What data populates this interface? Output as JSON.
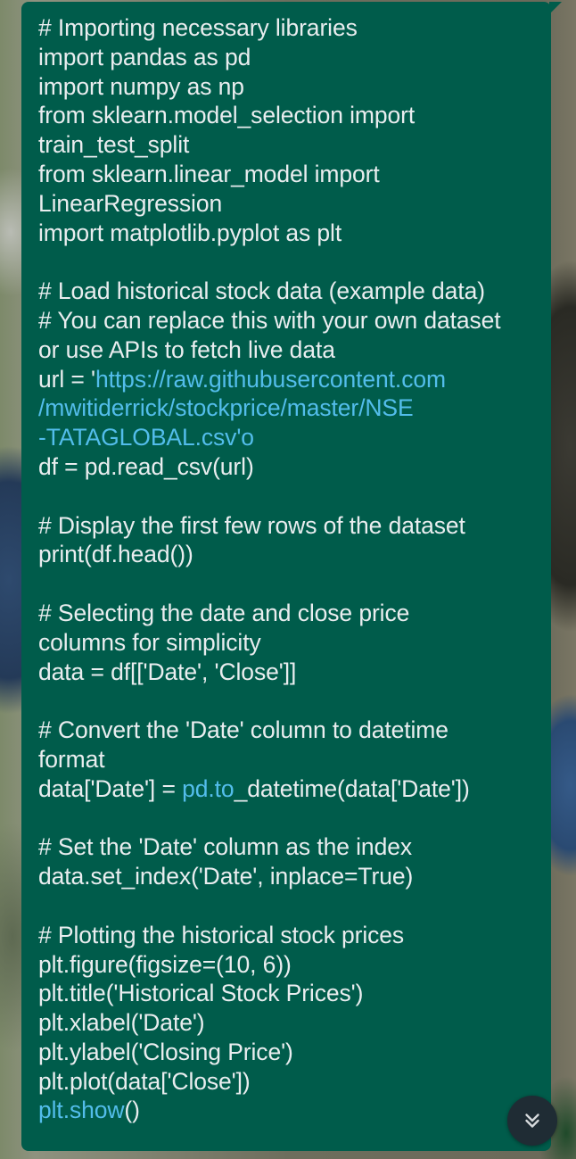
{
  "message": {
    "lines": [
      {
        "text": "# Importing necessary libraries"
      },
      {
        "text": "import pandas as pd"
      },
      {
        "text": "import numpy as np"
      },
      {
        "text": "from sklearn.model_selection import"
      },
      {
        "text": "train_test_split"
      },
      {
        "text": "from sklearn.linear_model import"
      },
      {
        "text": "LinearRegression"
      },
      {
        "text": "import matplotlib.pyplot as plt"
      },
      {
        "text": ""
      },
      {
        "text": "# Load historical stock data (example data)"
      },
      {
        "text": "# You can replace this with your own dataset"
      },
      {
        "text": "or use APIs to fetch live data"
      },
      {
        "pre": "url = '",
        "link": "https://raw.githubusercontent.com"
      },
      {
        "link": "/mwitiderrick/stockprice/master/NSE"
      },
      {
        "link": "-TATAGLOBAL.csv'o"
      },
      {
        "text": "df = pd.read_csv(url)"
      },
      {
        "text": ""
      },
      {
        "text": "# Display the first few rows of the dataset"
      },
      {
        "text": "print(df.head())"
      },
      {
        "text": ""
      },
      {
        "text": "# Selecting the date and close price"
      },
      {
        "text": "columns for simplicity"
      },
      {
        "text": "data = df[['Date', 'Close']]"
      },
      {
        "text": ""
      },
      {
        "text": "# Convert the 'Date' column to datetime"
      },
      {
        "text": "format"
      },
      {
        "pre": "data['Date'] = ",
        "link": "pd.to",
        "post": "_datetime(data['Date'])"
      },
      {
        "text": ""
      },
      {
        "text": "# Set the 'Date' column as the index"
      },
      {
        "text": "data.set_index('Date', inplace=True)"
      },
      {
        "text": ""
      },
      {
        "text": "# Plotting the historical stock prices"
      },
      {
        "text": "plt.figure(figsize=(10, 6))"
      },
      {
        "text": "plt.title('Historical Stock Prices')"
      },
      {
        "text": "plt.xlabel('Date')"
      },
      {
        "text": "plt.ylabel('Closing Price')"
      },
      {
        "text": "plt.plot(data['Close'])"
      },
      {
        "link": "plt.show",
        "post": "()"
      }
    ]
  },
  "scroll_button": {
    "icon": "double-chevron-down-icon"
  },
  "colors": {
    "bubble": "#005c4b",
    "text": "#e9edef",
    "link": "#53bdeb",
    "scroll_button": "#1f2c34"
  }
}
